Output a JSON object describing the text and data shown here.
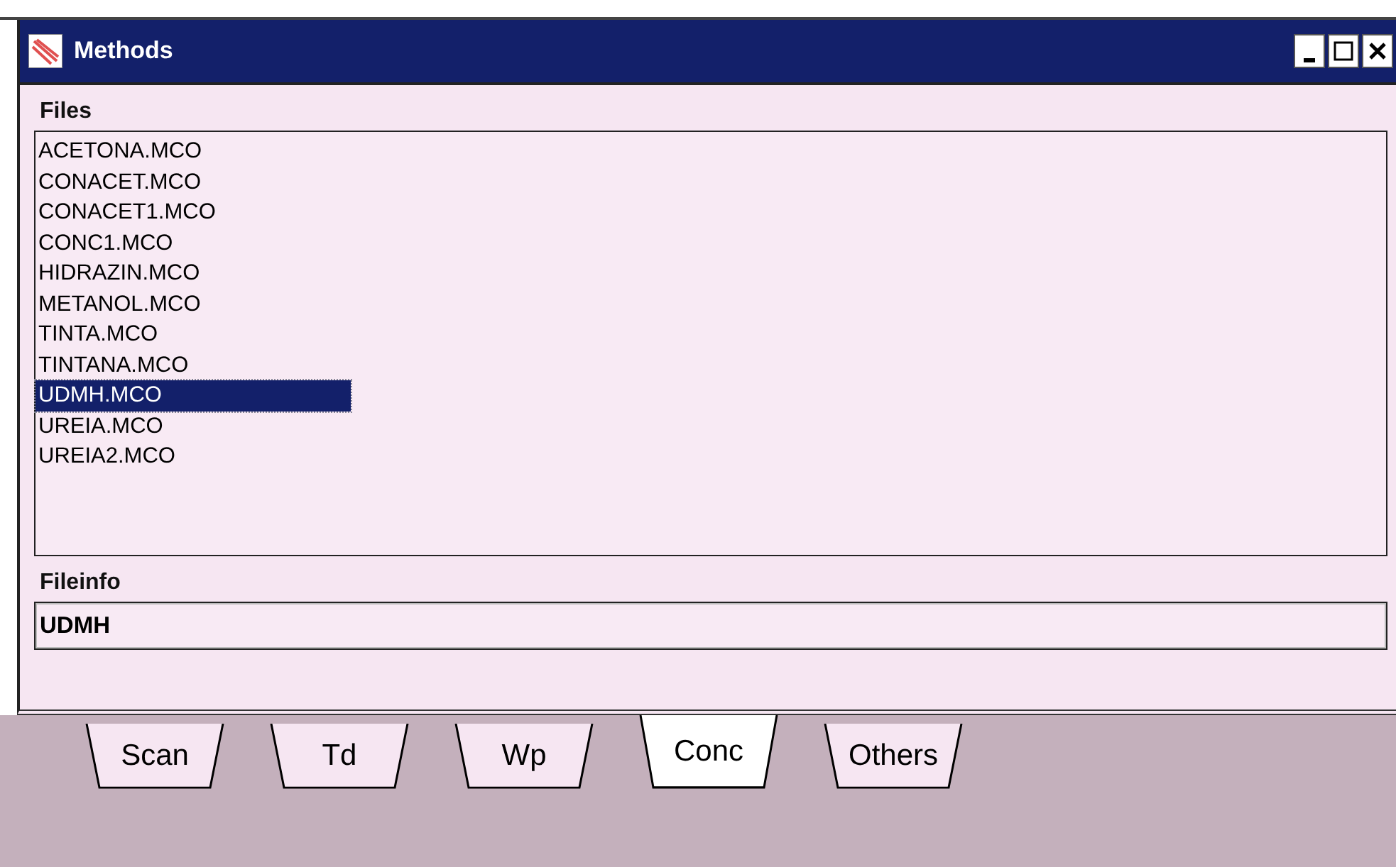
{
  "window": {
    "title": "Methods"
  },
  "files": {
    "label": "Files",
    "items": [
      {
        "name": "ACETONA.MCO",
        "selected": false
      },
      {
        "name": "CONACET.MCO",
        "selected": false
      },
      {
        "name": "CONACET1.MCO",
        "selected": false
      },
      {
        "name": "CONC1.MCO",
        "selected": false
      },
      {
        "name": "HIDRAZIN.MCO",
        "selected": false
      },
      {
        "name": "METANOL.MCO",
        "selected": false
      },
      {
        "name": "TINTA.MCO",
        "selected": false
      },
      {
        "name": "TINTANA.MCO",
        "selected": false
      },
      {
        "name": "UDMH.MCO",
        "selected": true
      },
      {
        "name": "UREIA.MCO",
        "selected": false
      },
      {
        "name": "UREIA2.MCO",
        "selected": false
      }
    ]
  },
  "fileinfo": {
    "label": "Fileinfo",
    "value": "UDMH"
  },
  "tabs": [
    {
      "label": "Scan",
      "selected": false
    },
    {
      "label": "Td",
      "selected": false
    },
    {
      "label": "Wp",
      "selected": false
    },
    {
      "label": "Conc",
      "selected": true
    },
    {
      "label": "Others",
      "selected": false
    }
  ]
}
